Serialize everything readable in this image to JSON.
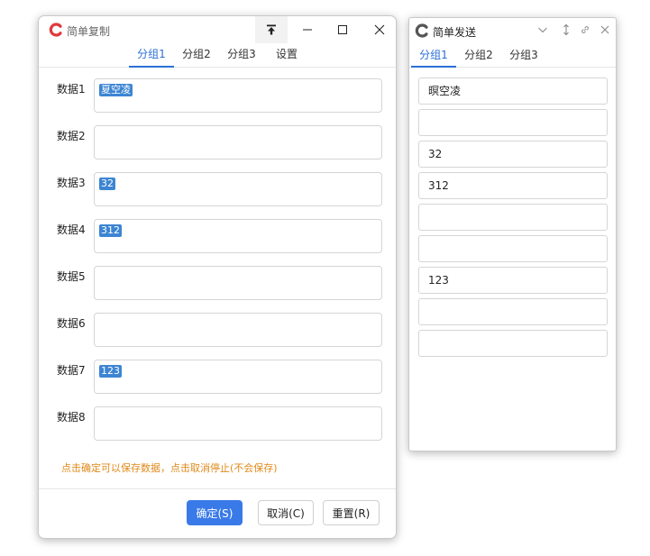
{
  "main_window": {
    "title": "简单复制",
    "tabs": [
      {
        "label": "分组1",
        "active": true
      },
      {
        "label": "分组2",
        "active": false
      },
      {
        "label": "分组3",
        "active": false
      },
      {
        "label": "设置",
        "active": false
      }
    ],
    "fields": [
      {
        "label": "数据1",
        "value": "夏空凌"
      },
      {
        "label": "数据2",
        "value": ""
      },
      {
        "label": "数据3",
        "value": "32"
      },
      {
        "label": "数据4",
        "value": "312"
      },
      {
        "label": "数据5",
        "value": ""
      },
      {
        "label": "数据6",
        "value": ""
      },
      {
        "label": "数据7",
        "value": "123"
      },
      {
        "label": "数据8",
        "value": ""
      }
    ],
    "hint": "点击确定可以保存数据，点击取消停止(不会保存)",
    "buttons": {
      "ok": "确定(S)",
      "cancel": "取消(C)",
      "reset": "重置(R)"
    },
    "icons": [
      "app-logo-icon",
      "pin-top-icon",
      "minimize-icon",
      "maximize-icon",
      "close-icon"
    ]
  },
  "send_window": {
    "title": "简单发送",
    "tabs": [
      {
        "label": "分组1",
        "active": true
      },
      {
        "label": "分组2",
        "active": false
      },
      {
        "label": "分组3",
        "active": false
      }
    ],
    "fields": [
      "暝空凌",
      "",
      "32",
      "312",
      "",
      "",
      "123",
      "",
      ""
    ],
    "icons": [
      "app-logo-icon",
      "chevron-down-icon",
      "vertical-resize-icon",
      "link-icon",
      "close-icon"
    ]
  },
  "colors": {
    "accent": "#2b6fd6",
    "primary_button": "#3a7ae8",
    "selection": "#3c85d3",
    "hint": "#e08a1a",
    "logo": "#e0393e"
  }
}
